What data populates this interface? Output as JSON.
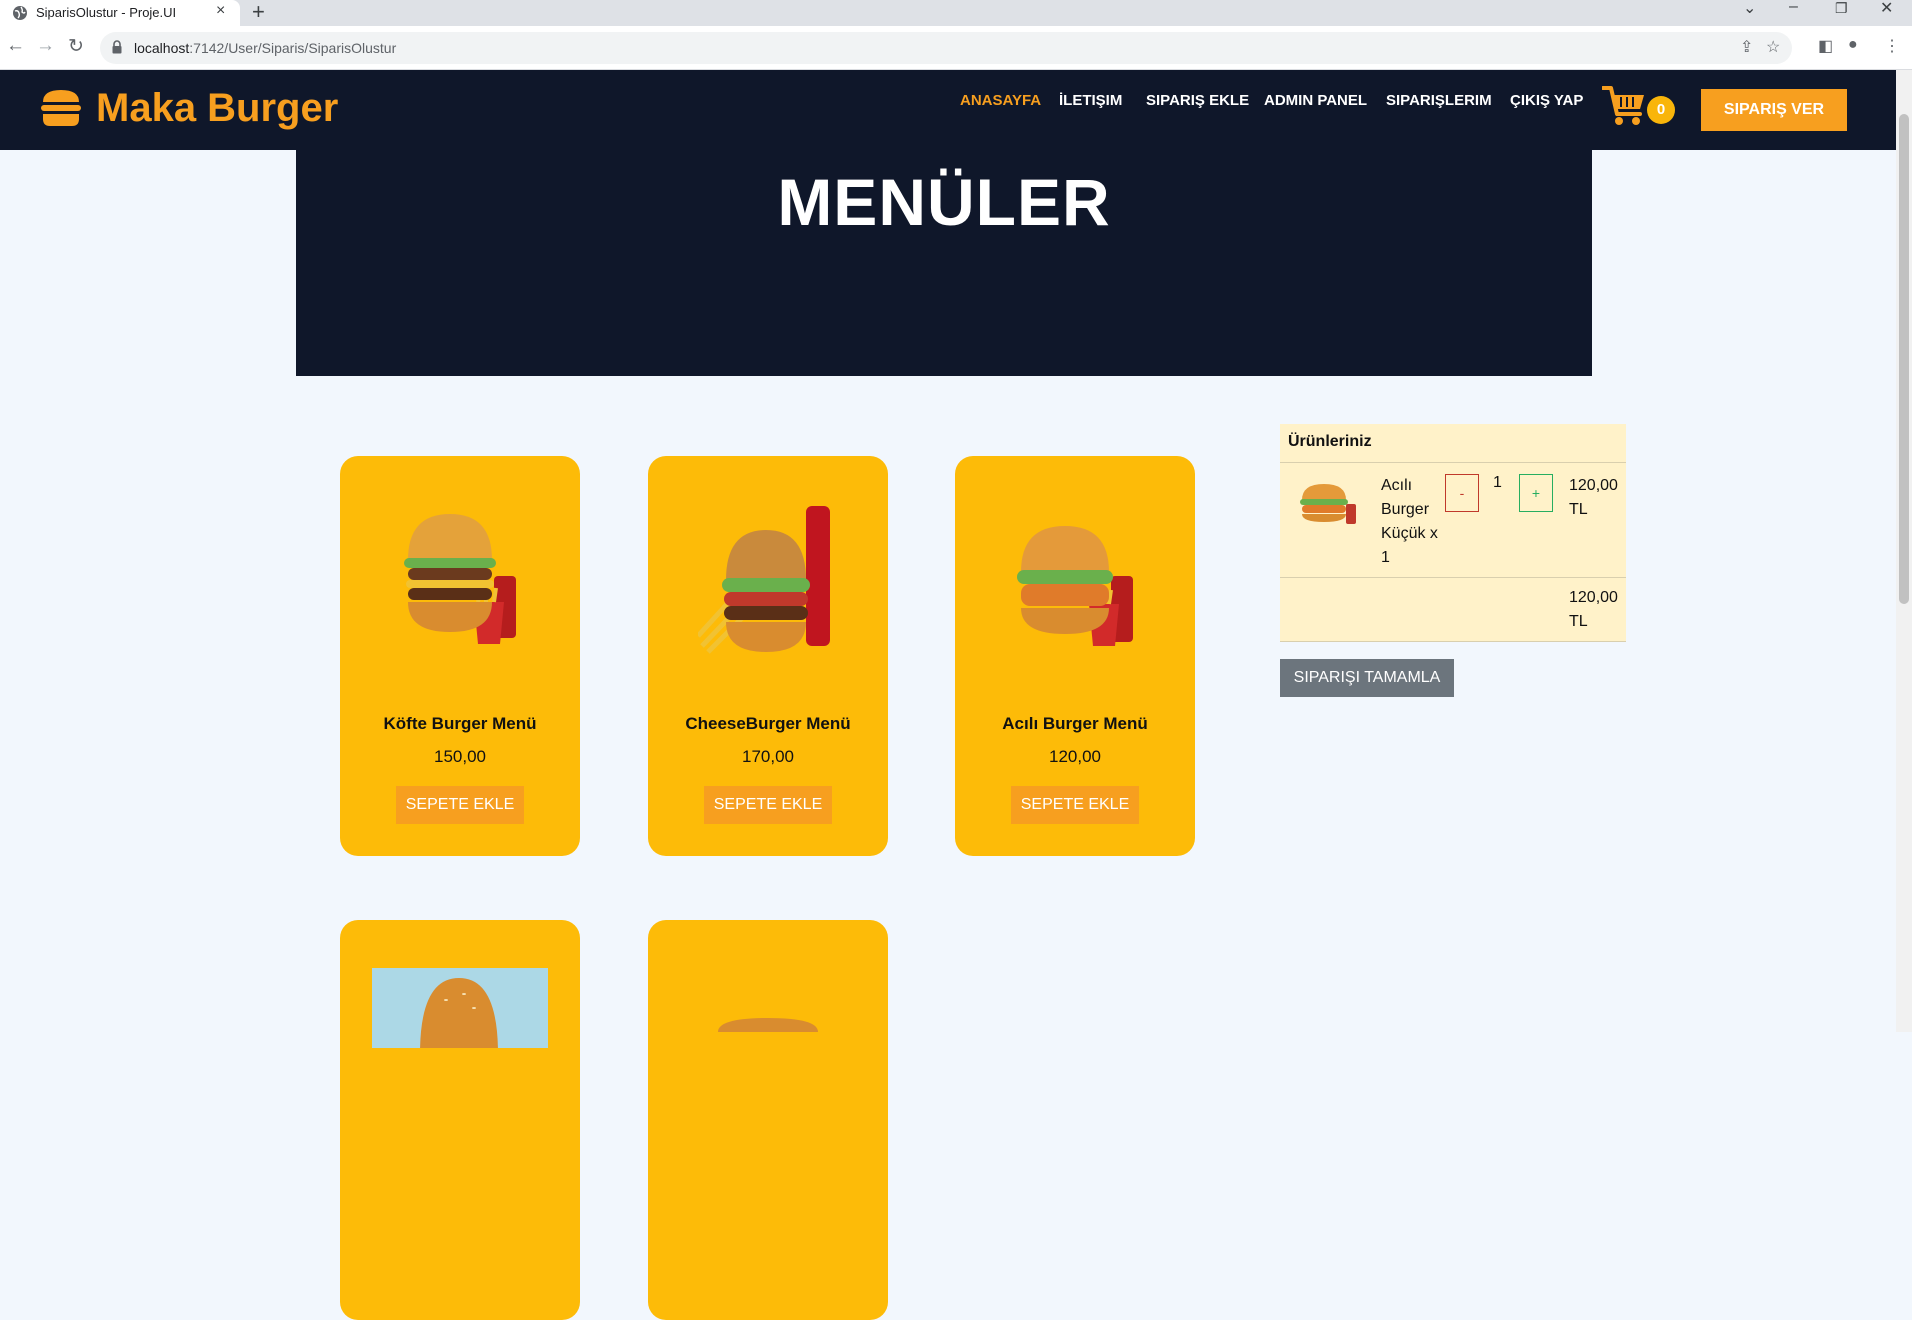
{
  "browser": {
    "tab_title": "SiparisOlustur - Proje.UI",
    "url_host": "localhost",
    "url_path": ":7142/User/Siparis/SiparisOlustur"
  },
  "header": {
    "brand": "Maka Burger",
    "nav": [
      "ANASAYFA",
      "İLETIŞIM",
      "SIPARIŞ EKLE",
      "ADMIN PANEL",
      "SIPARIŞLERIM",
      "ÇIKIŞ YAP"
    ],
    "active_nav": "ANASAYFA",
    "cart_count": "0",
    "order_button": "SIPARIŞ VER"
  },
  "hero": {
    "title": "MENÜLER"
  },
  "products": [
    {
      "name": "Köfte Burger Menü",
      "price": "150,00",
      "button": "SEPETE EKLE"
    },
    {
      "name": "CheeseBurger Menü",
      "price": "170,00",
      "button": "SEPETE EKLE"
    },
    {
      "name": "Acılı Burger Menü",
      "price": "120,00",
      "button": "SEPETE EKLE"
    }
  ],
  "cart": {
    "heading": "Ürünleriniz",
    "items": [
      {
        "name": "Acılı Burger Küçük x 1",
        "quantity": "1",
        "price": "120,00 TL"
      }
    ],
    "total": "120,00 TL",
    "minus_label": "-",
    "plus_label": "+",
    "complete_button": "SIPARIŞI TAMAMLA"
  },
  "colors": {
    "header_bg": "#0f172a",
    "accent_orange": "#f79f1f",
    "card_yellow": "#fdbb08",
    "page_bg": "#f2f7fd",
    "cart_panel_bg": "#fff2c9",
    "complete_button_bg": "#6c757d"
  },
  "icons": [
    "globe-icon",
    "close-icon",
    "plus-icon",
    "chevron-down-icon",
    "minimize-icon",
    "restore-icon",
    "window-close-icon",
    "back-icon",
    "forward-icon",
    "reload-icon",
    "lock-icon",
    "share-icon",
    "star-icon",
    "sidepanel-icon",
    "profile-icon",
    "kebab-menu-icon",
    "burger-logo-icon",
    "cart-icon"
  ]
}
